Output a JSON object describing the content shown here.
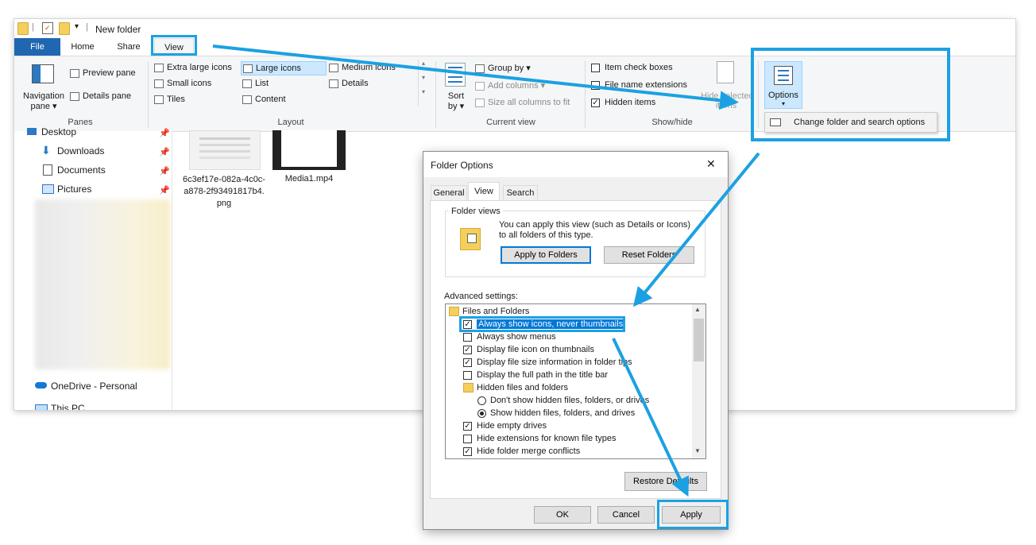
{
  "window": {
    "title": "New folder"
  },
  "tabs": {
    "file": "File",
    "home": "Home",
    "share": "Share",
    "view": "View"
  },
  "ribbon": {
    "panes": {
      "navigation_pane": "Navigation",
      "navigation_pane2": "pane ▾",
      "preview_pane": "Preview pane",
      "details_pane": "Details pane",
      "label": "Panes"
    },
    "layout": {
      "extra_large": "Extra large icons",
      "large": "Large icons",
      "medium": "Medium icons",
      "small": "Small icons",
      "list": "List",
      "details": "Details",
      "tiles": "Tiles",
      "content": "Content",
      "label": "Layout"
    },
    "current_view": {
      "sort": "Sort",
      "sort2": "by ▾",
      "group_by": "Group by ▾",
      "add_columns": "Add columns ▾",
      "size_all": "Size all columns to fit",
      "label": "Current view"
    },
    "show_hide": {
      "item_check": "Item check boxes",
      "file_ext": "File name extensions",
      "hidden_items": "Hidden items",
      "hide_selected": "Hide selected",
      "hide_selected2": "items",
      "label": "Show/hide"
    },
    "options": {
      "label": "Options",
      "arrow": "▾",
      "menu_item": "Change folder and search options"
    }
  },
  "nav": {
    "desktop": "Desktop",
    "downloads": "Downloads",
    "documents": "Documents",
    "pictures": "Pictures",
    "onedrive": "OneDrive - Personal",
    "thispc": "This PC"
  },
  "files": [
    {
      "name": "6c3ef17e-082a-4c0c-a878-2f93491817b4.png"
    },
    {
      "name": "Media1.mp4"
    }
  ],
  "dialog": {
    "title": "Folder Options",
    "close": "✕",
    "tabs": {
      "general": "General",
      "view": "View",
      "search": "Search"
    },
    "folder_views": {
      "legend": "Folder views",
      "text": "You can apply this view (such as Details or Icons) to all folders of this type.",
      "apply_btn": "Apply to Folders",
      "reset_btn": "Reset Folders"
    },
    "advanced_label": "Advanced settings:",
    "advanced": {
      "files_and_folders": "Files and Folders",
      "always_icons": "Always show icons, never thumbnails",
      "always_menus": "Always show menus",
      "display_icon_thumbs": "Display file icon on thumbnails",
      "display_size": "Display file size information in folder tips",
      "full_path": "Display the full path in the title bar",
      "hidden_files": "Hidden files and folders",
      "dont_show": "Don't show hidden files, folders, or drives",
      "show_hidden": "Show hidden files, folders, and drives",
      "hide_empty": "Hide empty drives",
      "hide_ext": "Hide extensions for known file types",
      "hide_merge": "Hide folder merge conflicts"
    },
    "restore": "Restore Defaults",
    "ok": "OK",
    "cancel": "Cancel",
    "apply": "Apply"
  },
  "colors": {
    "highlight": "#1ba1e2",
    "file_tab": "#1f67b1",
    "selection": "#0078d7"
  }
}
